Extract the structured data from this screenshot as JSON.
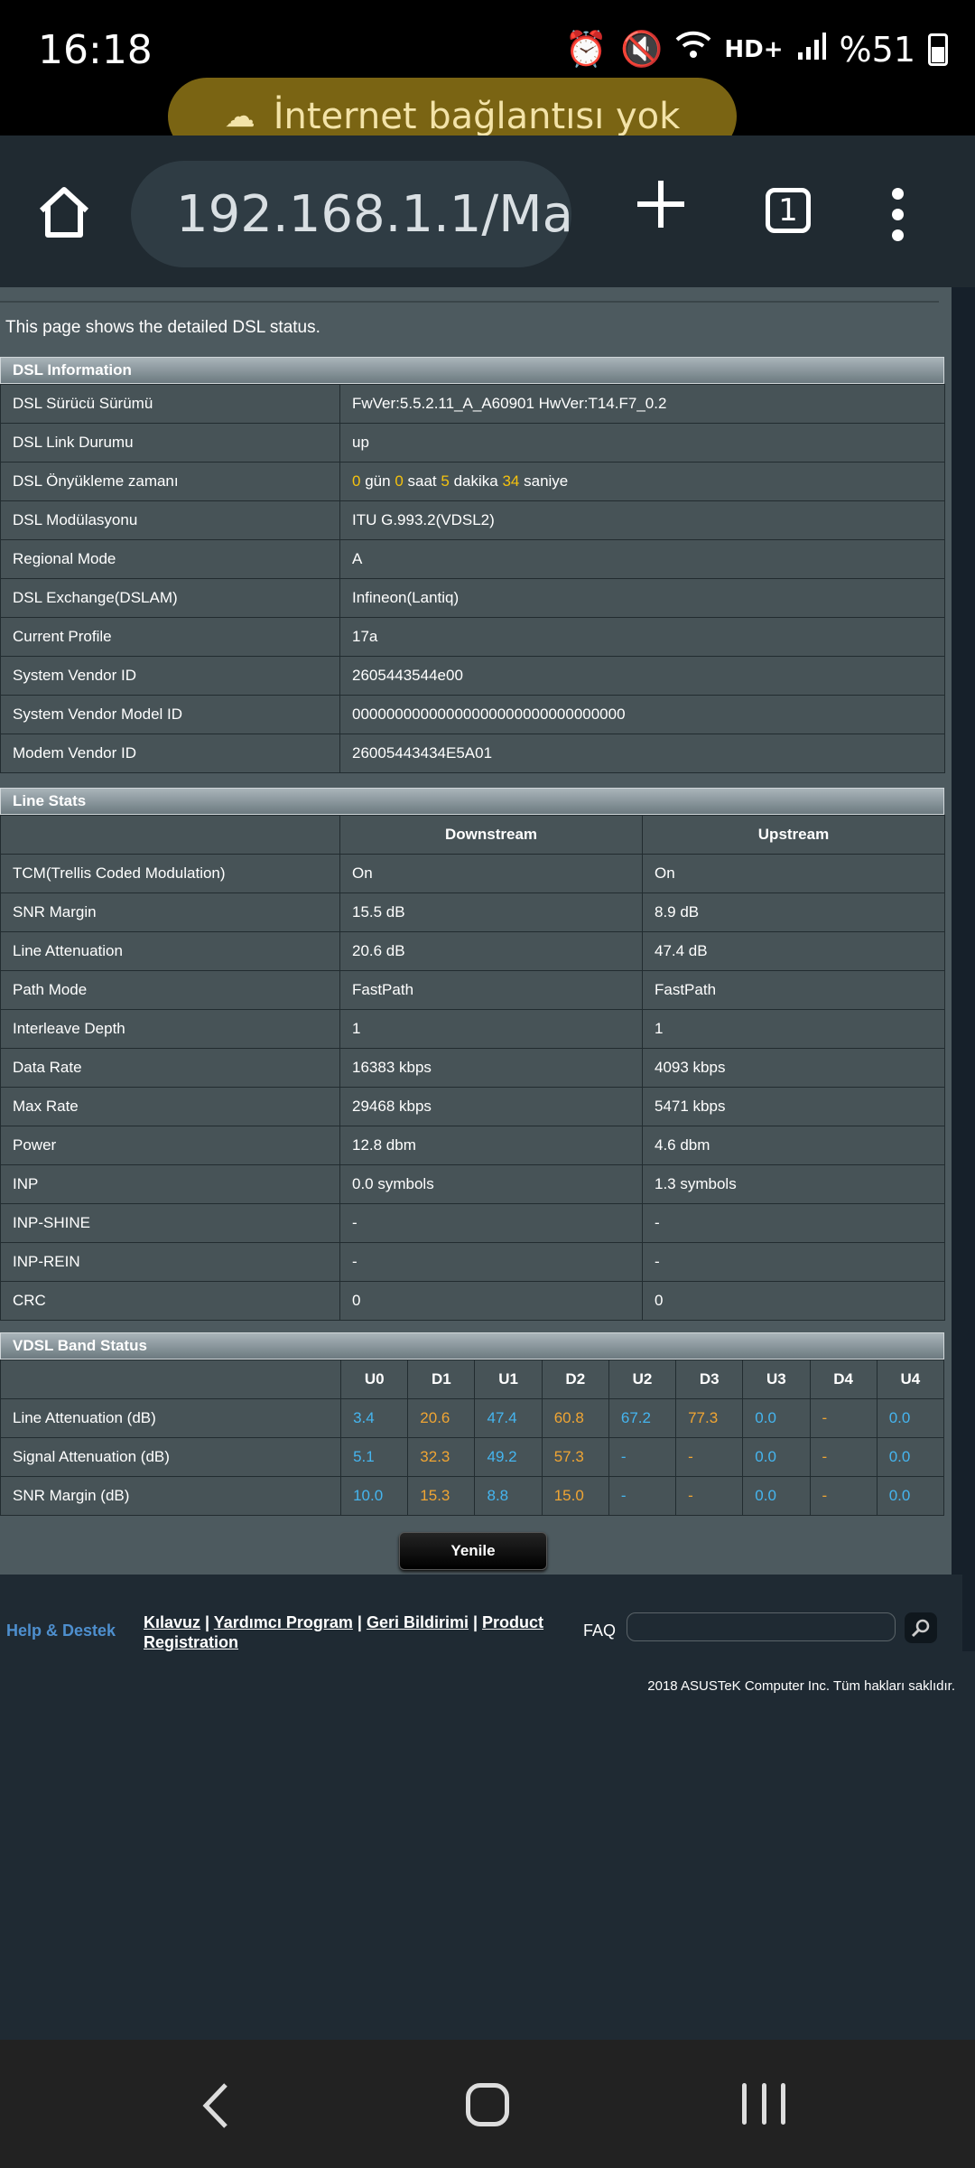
{
  "status_bar": {
    "time": "16:18",
    "battery": "%51",
    "icons": [
      "alarm-icon",
      "mute-icon",
      "wifi-icon",
      "hd-plus-icon",
      "signal-icon",
      "battery-icon"
    ],
    "hd_label": "HD+",
    "offline_banner": "İnternet bağlantısı yok"
  },
  "browser": {
    "url": "192.168.1.1/Ma",
    "tab_count": "1"
  },
  "page": {
    "intro": "This page shows the detailed DSL status."
  },
  "dsl_info": {
    "title": "DSL Information",
    "rows": [
      {
        "label": "DSL Sürücü Sürümü",
        "value": "FwVer:5.5.2.11_A_A60901 HwVer:T14.F7_0.2"
      },
      {
        "label": "DSL Link Durumu",
        "value": "up"
      },
      {
        "label": "DSL Önyükleme zamanı",
        "value": ""
      },
      {
        "label": "DSL Modülasyonu",
        "value": "ITU G.993.2(VDSL2)"
      },
      {
        "label": "Regional Mode",
        "value": "A"
      },
      {
        "label": "DSL Exchange(DSLAM)",
        "value": "Infineon(Lantiq)"
      },
      {
        "label": "Current Profile",
        "value": "17a"
      },
      {
        "label": "System Vendor ID",
        "value": "2605443544e00"
      },
      {
        "label": "System Vendor Model ID",
        "value": "00000000000000000000000000000000"
      },
      {
        "label": "Modem Vendor ID",
        "value": "26005443434E5A01"
      }
    ],
    "uptime": {
      "days": "0",
      "days_unit": "gün",
      "hours": "0",
      "hours_unit": "saat",
      "minutes": "5",
      "minutes_unit": "dakika",
      "seconds": "34",
      "seconds_unit": "saniye"
    }
  },
  "line_stats": {
    "title": "Line Stats",
    "headers": [
      "Downstream",
      "Upstream"
    ],
    "rows": [
      {
        "label": "TCM(Trellis Coded Modulation)",
        "down": "On",
        "up": "On"
      },
      {
        "label": "SNR Margin",
        "down": "15.5 dB",
        "up": "8.9 dB"
      },
      {
        "label": "Line Attenuation",
        "down": "20.6 dB",
        "up": "47.4 dB"
      },
      {
        "label": "Path Mode",
        "down": "FastPath",
        "up": "FastPath"
      },
      {
        "label": "Interleave Depth",
        "down": "1",
        "up": "1"
      },
      {
        "label": "Data Rate",
        "down": "16383 kbps",
        "up": "4093 kbps"
      },
      {
        "label": "Max Rate",
        "down": "29468 kbps",
        "up": "5471 kbps"
      },
      {
        "label": "Power",
        "down": "12.8 dbm",
        "up": "4.6 dbm"
      },
      {
        "label": "INP",
        "down": "0.0 symbols",
        "up": "1.3 symbols"
      },
      {
        "label": "INP-SHINE",
        "down": "-",
        "up": "-"
      },
      {
        "label": "INP-REIN",
        "down": "-",
        "up": "-"
      },
      {
        "label": "CRC",
        "down": "0",
        "up": "0"
      }
    ]
  },
  "vdsl_band": {
    "title": "VDSL Band Status",
    "bands": [
      "U0",
      "D1",
      "U1",
      "D2",
      "U2",
      "D3",
      "U3",
      "D4",
      "U4"
    ],
    "colors": {
      "upstream": "#45b5ef",
      "downstream": "#f0a533"
    },
    "rows": [
      {
        "label": "Line Attenuation (dB)",
        "values": [
          "3.4",
          "20.6",
          "47.4",
          "60.8",
          "67.2",
          "77.3",
          "0.0",
          "-",
          "0.0"
        ]
      },
      {
        "label": "Signal Attenuation (dB)",
        "values": [
          "5.1",
          "32.3",
          "49.2",
          "57.3",
          "-",
          "-",
          "0.0",
          "-",
          "0.0"
        ]
      },
      {
        "label": "SNR Margin (dB)",
        "values": [
          "10.0",
          "15.3",
          "8.8",
          "15.0",
          "-",
          "-",
          "0.0",
          "-",
          "0.0"
        ]
      }
    ]
  },
  "refresh_button": "Yenile",
  "footer": {
    "help": "Help & Destek",
    "link_manual": "Kılavuz",
    "link_utility": "Yardımcı Program",
    "link_feedback": "Geri Bildirimi",
    "link_registration": "Product Registration",
    "separator": "|",
    "faq": "FAQ",
    "copyright": "2018 ASUSTeK Computer Inc. Tüm hakları saklıdır."
  }
}
